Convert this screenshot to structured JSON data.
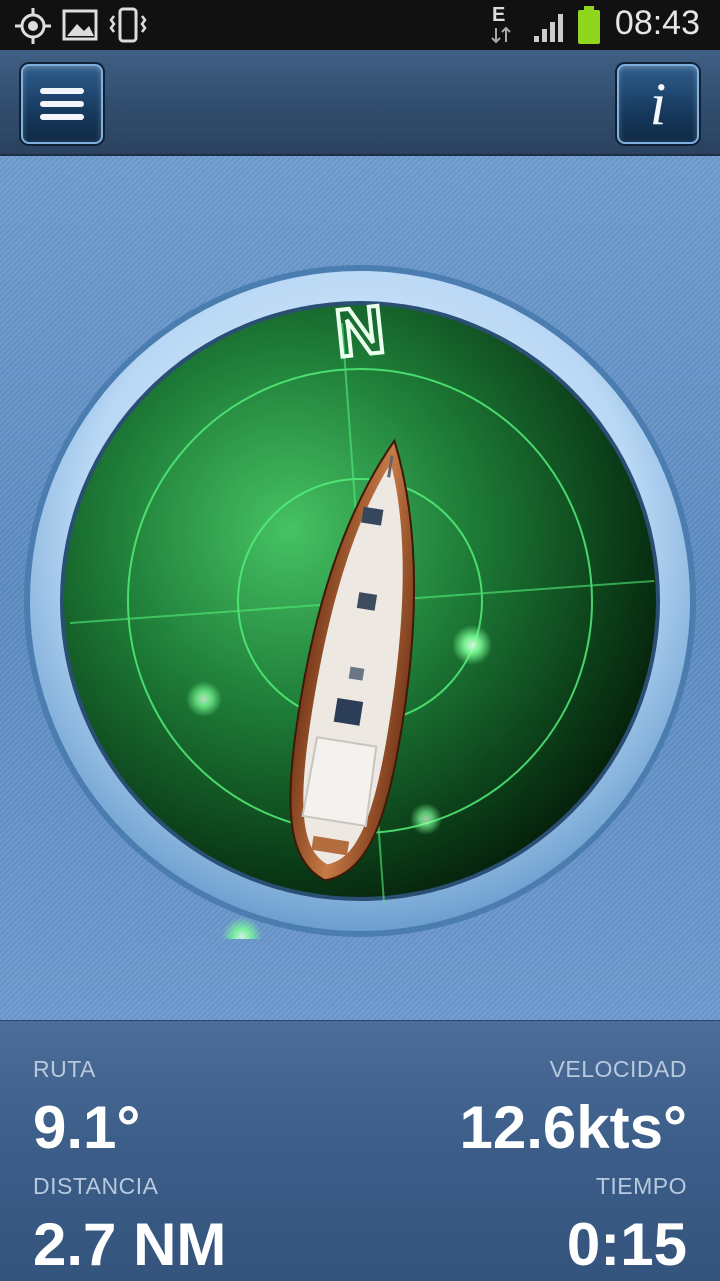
{
  "status_bar": {
    "time": "08:43",
    "network": "E",
    "icons": [
      "gps-icon",
      "image-icon",
      "vibrate-icon",
      "data-arrows-icon",
      "signal-icon",
      "battery-icon"
    ]
  },
  "toolbar": {
    "menu_icon": "hamburger-menu-icon",
    "info_icon": "info-icon",
    "info_glyph": "i"
  },
  "radar": {
    "north_label": "N",
    "colors": {
      "screen": "#1f8a3a",
      "ring": "#cfe6fb",
      "grid": "#5dff82"
    }
  },
  "stats": {
    "ruta_label": "RUTA",
    "ruta_value": "9.1°",
    "velocidad_label": "VELOCIDAD",
    "velocidad_value": "12.6kts°",
    "distancia_label": "DISTANCIA",
    "distancia_value": "2.7 NM",
    "tiempo_label": "TIEMPO",
    "tiempo_value": "0:15"
  }
}
